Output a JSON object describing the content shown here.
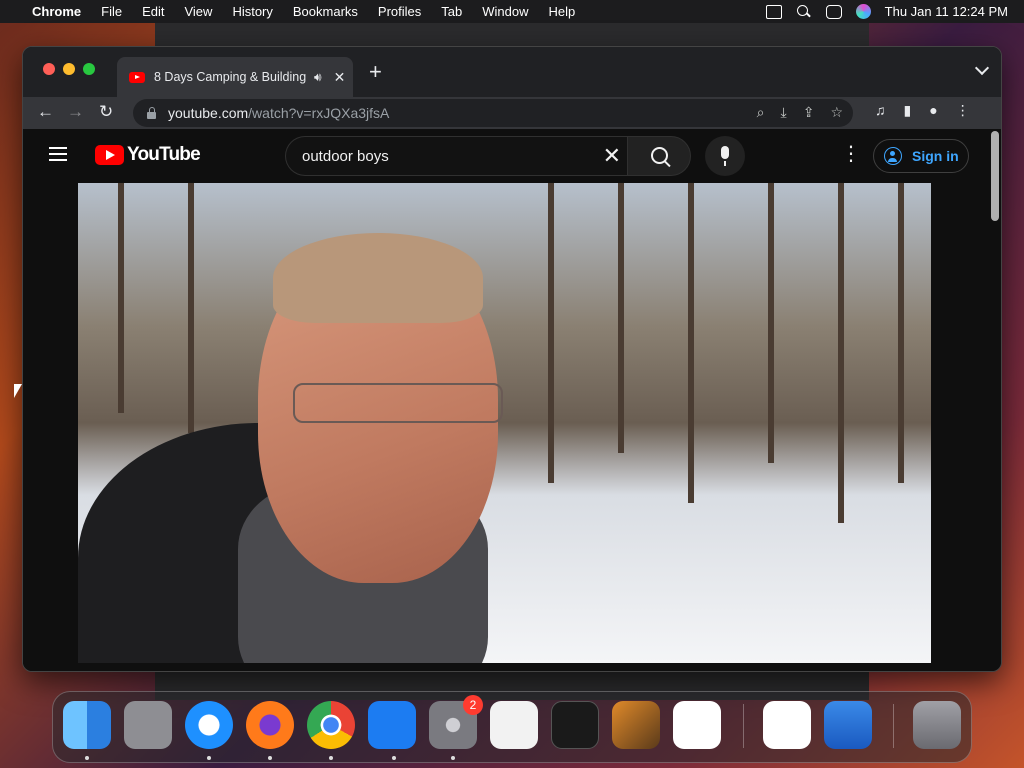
{
  "menubar": {
    "app_name": "Chrome",
    "items": [
      "File",
      "Edit",
      "View",
      "History",
      "Bookmarks",
      "Profiles",
      "Tab",
      "Window",
      "Help"
    ],
    "clock": "Thu Jan 11  12:24 PM"
  },
  "browser": {
    "tab_title": "8 Days Camping & Building",
    "new_tab_symbol": "+",
    "url_host": "youtube.com",
    "url_path": "/watch?v=rxJQXa3jfsA"
  },
  "youtube": {
    "logo_text": "YouTube",
    "search_value": "outdoor boys",
    "sign_in_label": "Sign in"
  },
  "dock": {
    "apps": [
      {
        "name": "Finder",
        "color": "#3a8ee8"
      },
      {
        "name": "Launchpad",
        "color": "#8e8e93"
      },
      {
        "name": "Safari",
        "color": "#1e90ff"
      },
      {
        "name": "Firefox",
        "color": "#ff7a1a"
      },
      {
        "name": "Chrome",
        "color": "#e8e8e8"
      },
      {
        "name": "App Store",
        "color": "#1c7cf2"
      },
      {
        "name": "System Settings",
        "color": "#7a7a80",
        "badge": "2"
      },
      {
        "name": "TextEdit",
        "color": "#f2f2f2"
      },
      {
        "name": "Terminal",
        "color": "#1a1a1a"
      },
      {
        "name": "GarageBand",
        "color": "#5a3a1a"
      },
      {
        "name": "VS Code",
        "color": "#2a8ae0"
      },
      {
        "name": "Visual Studio",
        "color": "#7a4ad0"
      },
      {
        "name": "Weather",
        "color": "#2a7ae0"
      },
      {
        "name": "Trash",
        "color": "#8e8e93"
      }
    ]
  }
}
